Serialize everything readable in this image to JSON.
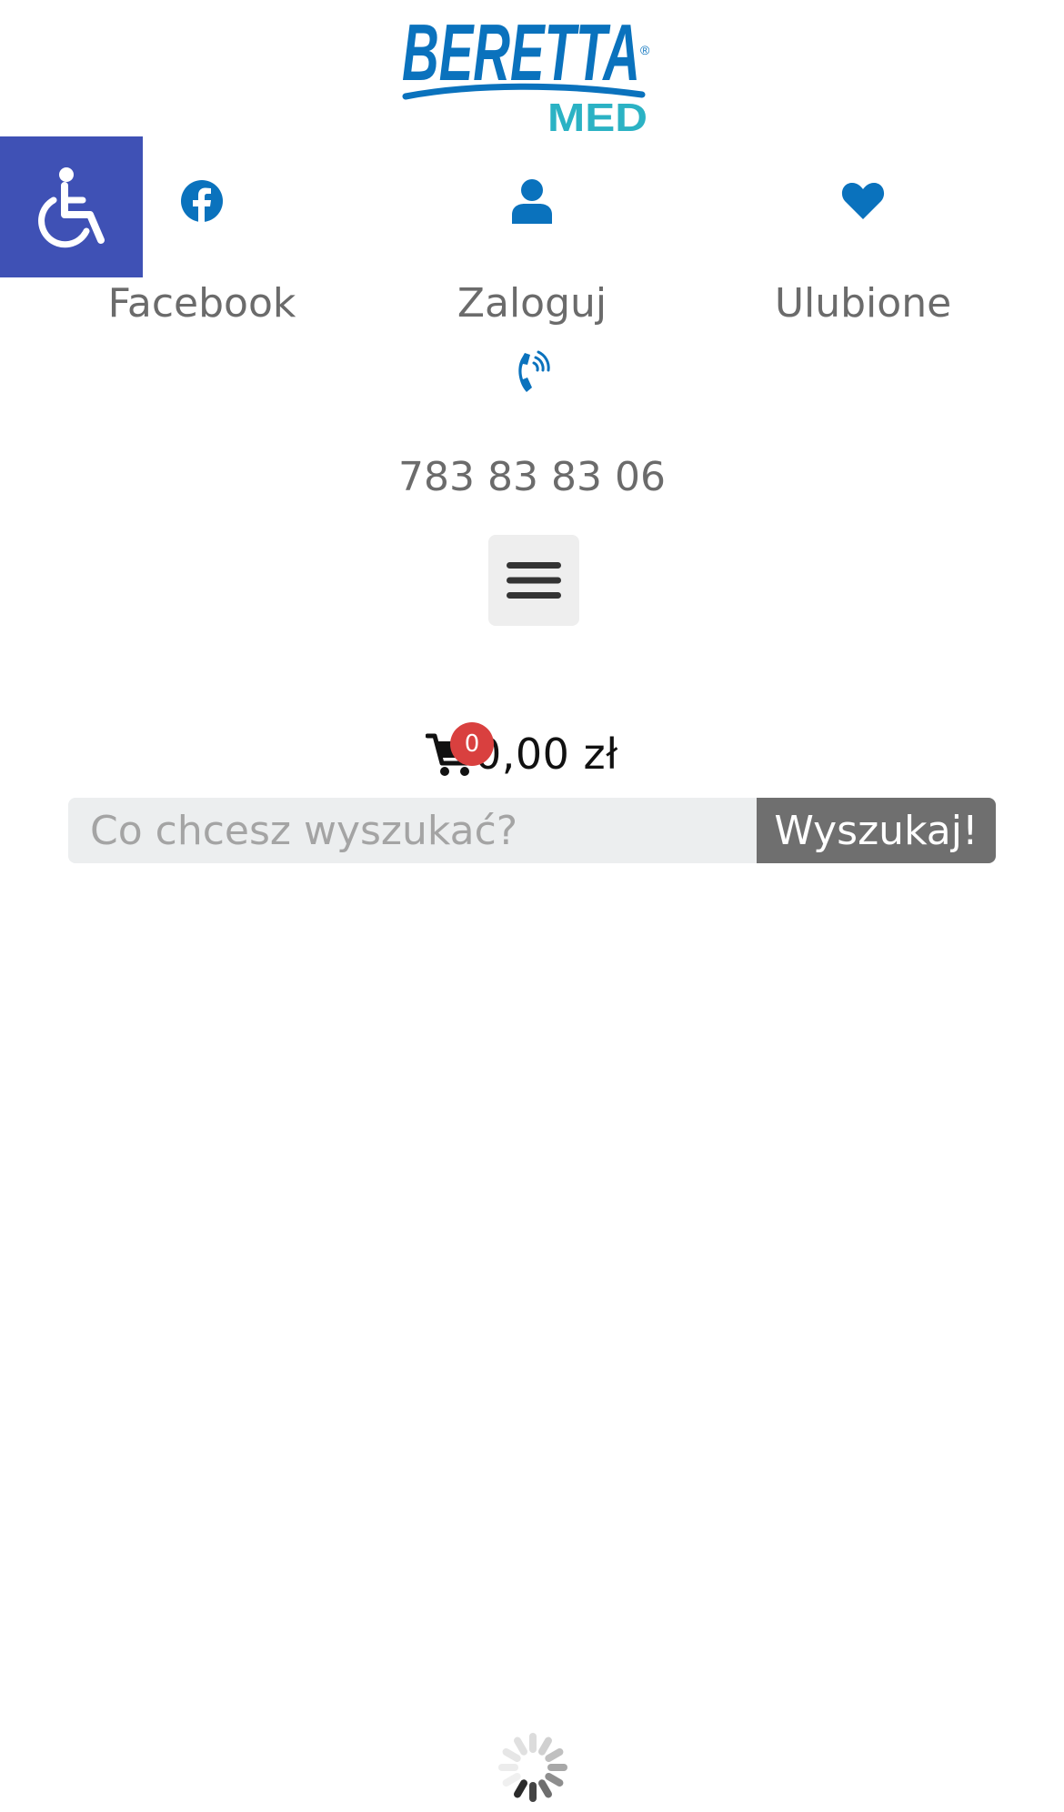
{
  "header": {
    "logo": {
      "brand": "BERETTA",
      "sub": "MED",
      "registered": "®"
    },
    "accessibility_icon": "wheelchair-icon",
    "top_links": [
      {
        "label": "Facebook",
        "icon": "facebook-icon"
      },
      {
        "label": "Zaloguj",
        "icon": "user-icon"
      },
      {
        "label": "Ulubione",
        "icon": "heart-icon"
      }
    ],
    "phone": {
      "icon": "phone-icon",
      "number": "783 83 83 06"
    },
    "menu_icon": "hamburger-icon"
  },
  "cart": {
    "count": "0",
    "total": "0,00 zł",
    "icon": "cart-icon"
  },
  "search": {
    "placeholder": "Co chcesz wyszukać?",
    "value": "",
    "button_label": "Wyszukaj!"
  },
  "colors": {
    "brand_blue": "#0a72bd",
    "brand_teal": "#2bb2c4",
    "accessibility_bg": "#3f51b5",
    "text_gray": "#6b6b6b",
    "badge_red": "#d9403f",
    "search_btn": "#6f6f6f",
    "search_bg": "#eceeef"
  },
  "loading_icon": "spinner-icon"
}
